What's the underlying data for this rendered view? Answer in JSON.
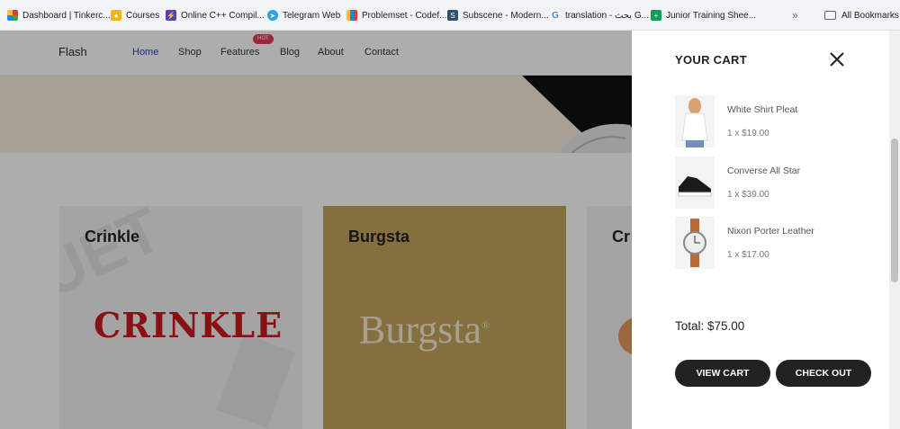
{
  "bookmarks": [
    {
      "label": "Dashboard | Tinkerc...",
      "icon": "grid-icon",
      "color": "#e53935"
    },
    {
      "label": "Courses",
      "icon": "courses-icon",
      "color": "#f2b705"
    },
    {
      "label": "Online C++ Compil...",
      "icon": "lightning-icon",
      "color": "#5b3fb6"
    },
    {
      "label": "Telegram Web",
      "icon": "telegram-icon",
      "color": "#2aa3e0"
    },
    {
      "label": "Problemset - Codef...",
      "icon": "bars-icon",
      "color": "#1e88e5"
    },
    {
      "label": "Subscene - Modern...",
      "icon": "s-icon",
      "color": "#2f4f6f"
    },
    {
      "label": "translation - بحث G...",
      "icon": "google-icon",
      "color": "#4285f4"
    },
    {
      "label": "Junior Training Shee...",
      "icon": "sheet-icon",
      "color": "#0f9d58"
    }
  ],
  "bookmarks_more": "»",
  "all_bookmarks": "All Bookmarks",
  "site": {
    "logo": "Flash",
    "nav": [
      "Home",
      "Shop",
      "Features",
      "Blog",
      "About",
      "Contact"
    ],
    "hot_badge": "HOT",
    "brands": [
      {
        "title": "Crinkle",
        "logo_text": "CRINKLE"
      },
      {
        "title": "Burgsta",
        "logo_text": "Burgsta",
        "mark": "®"
      },
      {
        "title": "Cr"
      }
    ]
  },
  "cart": {
    "title": "YOUR CART",
    "items": [
      {
        "name": "White Shirt Pleat",
        "qty": "1 x $19.00"
      },
      {
        "name": "Converse All Star",
        "qty": "1 x $39.00"
      },
      {
        "name": "Nixon Porter Leather",
        "qty": "1 x $17.00"
      }
    ],
    "total": "Total: $75.00",
    "view_cart": "VIEW CART",
    "check_out": "CHECK OUT"
  },
  "colors": {
    "accent": "#2a3cc8",
    "hot": "#e8395a",
    "button": "#222222",
    "burgsta_bg": "#c6a45c",
    "crinkle_red": "#c91a20"
  }
}
